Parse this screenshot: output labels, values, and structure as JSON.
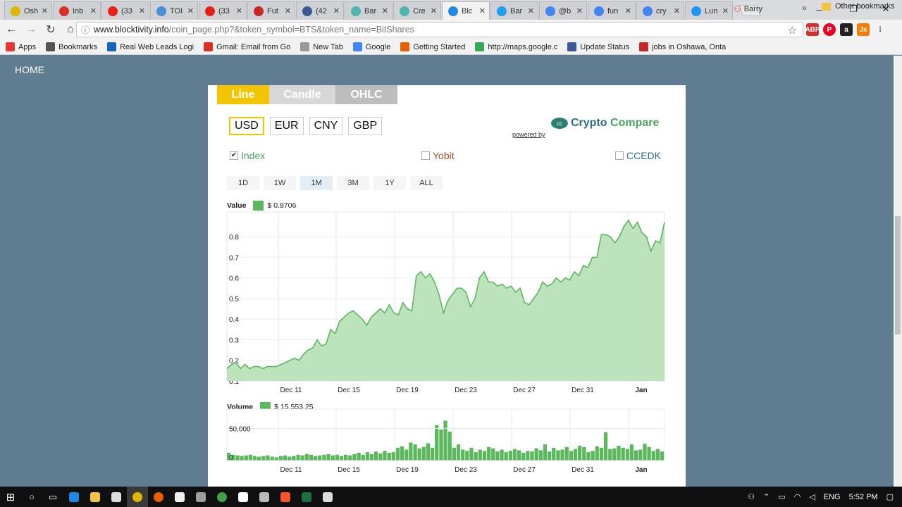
{
  "browser": {
    "tabs": [
      {
        "label": "Osh",
        "color": "#e0b500"
      },
      {
        "label": "Inb",
        "color": "#d93025"
      },
      {
        "label": "(33",
        "color": "#e62117"
      },
      {
        "label": "TOI",
        "color": "#4a90d9"
      },
      {
        "label": "(33",
        "color": "#e62117"
      },
      {
        "label": "Fut",
        "color": "#c62828"
      },
      {
        "label": "(42",
        "color": "#3b5998"
      },
      {
        "label": "Bar",
        "color": "#4db6ac"
      },
      {
        "label": "Cre",
        "color": "#4db6ac"
      },
      {
        "label": "Blc",
        "color": "#1e88e5"
      },
      {
        "label": "Bar",
        "color": "#1da1f2"
      },
      {
        "label": "@b",
        "color": "#4285f4"
      },
      {
        "label": "fun",
        "color": "#4285f4"
      },
      {
        "label": "cry",
        "color": "#4285f4"
      },
      {
        "label": "Lun",
        "color": "#2196f3"
      }
    ],
    "active_tab": 9,
    "profile": "Barry",
    "url_host": "www.blocktivity.info",
    "url_path": "/coin_page.php?&token_symbol=BTS&token_name=BitShares",
    "bookmarks": [
      {
        "label": "Apps",
        "color": "#e53935"
      },
      {
        "label": "Bookmarks",
        "color": "#555"
      },
      {
        "label": "Real Web Leads Logi",
        "color": "#1565c0"
      },
      {
        "label": "Gmail: Email from Go",
        "color": "#d93025"
      },
      {
        "label": "New Tab",
        "color": "#999"
      },
      {
        "label": "Google",
        "color": "#4285f4"
      },
      {
        "label": "Getting Started",
        "color": "#e66000"
      },
      {
        "label": "http://maps.google.c",
        "color": "#34a853"
      },
      {
        "label": "Update Status",
        "color": "#3b5998"
      },
      {
        "label": "jobs in Oshawa, Onta",
        "color": "#c62828"
      }
    ],
    "bookmarks_more": "»",
    "other_bookmarks": "Other bookmarks"
  },
  "page": {
    "home": "HOME",
    "chart_tabs": [
      {
        "label": "Line",
        "color": "#f2c500"
      },
      {
        "label": "Candle",
        "color": "#d7d7d7"
      },
      {
        "label": "OHLC",
        "color": "#bdbdbd"
      }
    ],
    "currencies": [
      "USD",
      "EUR",
      "CNY",
      "GBP"
    ],
    "selected_currency": "USD",
    "powered_by": "powered by",
    "cc_name_a": "Crypto",
    "cc_name_b": "Compare",
    "exchanges": [
      {
        "label": "Index",
        "checked": "✔",
        "color": "#4aa35d"
      },
      {
        "label": "Yobit",
        "checked": "",
        "color": "#a0522d"
      },
      {
        "label": "CCEDK",
        "checked": "",
        "color": "#2d6c8a"
      }
    ],
    "ranges": [
      "1D",
      "1W",
      "1M",
      "3M",
      "1Y",
      "ALL"
    ],
    "selected_range": "1M",
    "value_label": "Value",
    "value_readout": "$ 0.8706",
    "volume_label": "Volume",
    "volume_readout": "$ 15,553.25"
  },
  "chart_data": [
    {
      "type": "area",
      "title": "",
      "y_ticks": [
        "0.1",
        "0.2",
        "0.3",
        "0.4",
        "0.5",
        "0.6",
        "0.7",
        "0.8"
      ],
      "ylim": [
        0.1,
        0.92
      ],
      "x_ticks": [
        "Dec 11",
        "Dec 15",
        "Dec 19",
        "Dec 23",
        "Dec 27",
        "Dec 31",
        "Jan"
      ],
      "grid": true,
      "color": "#5cb85c",
      "values": [
        0.16,
        0.18,
        0.19,
        0.16,
        0.18,
        0.16,
        0.17,
        0.17,
        0.16,
        0.17,
        0.17,
        0.17,
        0.18,
        0.19,
        0.2,
        0.21,
        0.2,
        0.23,
        0.25,
        0.26,
        0.3,
        0.27,
        0.28,
        0.35,
        0.33,
        0.39,
        0.41,
        0.43,
        0.44,
        0.42,
        0.4,
        0.37,
        0.41,
        0.43,
        0.45,
        0.43,
        0.47,
        0.43,
        0.42,
        0.48,
        0.45,
        0.44,
        0.61,
        0.63,
        0.6,
        0.62,
        0.58,
        0.52,
        0.43,
        0.49,
        0.52,
        0.55,
        0.55,
        0.53,
        0.46,
        0.5,
        0.6,
        0.63,
        0.58,
        0.58,
        0.56,
        0.57,
        0.55,
        0.56,
        0.53,
        0.55,
        0.48,
        0.47,
        0.5,
        0.53,
        0.58,
        0.56,
        0.57,
        0.6,
        0.58,
        0.6,
        0.59,
        0.63,
        0.61,
        0.66,
        0.65,
        0.7,
        0.7,
        0.81,
        0.81,
        0.8,
        0.77,
        0.8,
        0.85,
        0.88,
        0.84,
        0.87,
        0.82,
        0.8,
        0.73,
        0.78,
        0.77,
        0.87
      ]
    },
    {
      "type": "bar",
      "title": "",
      "y_ticks": [
        "0",
        "50,000"
      ],
      "ylim": [
        0,
        80000
      ],
      "x_ticks": [
        "Dec 11",
        "Dec 15",
        "Dec 19",
        "Dec 23",
        "Dec 27",
        "Dec 31",
        "Jan"
      ],
      "color": "#5cb85c",
      "values": [
        12000,
        9000,
        8000,
        7000,
        8000,
        9000,
        7000,
        6000,
        7000,
        8000,
        6000,
        5000,
        7000,
        8000,
        6000,
        7000,
        9000,
        8000,
        10000,
        9000,
        7000,
        8000,
        9000,
        10000,
        8000,
        9000,
        7000,
        9000,
        8000,
        10000,
        12000,
        9000,
        13000,
        10000,
        14000,
        11000,
        15000,
        12000,
        13000,
        20000,
        22000,
        17000,
        28000,
        25000,
        19000,
        21000,
        27000,
        20000,
        55000,
        48000,
        62000,
        45000,
        20000,
        25000,
        17000,
        15000,
        20000,
        13000,
        17000,
        15000,
        21000,
        19000,
        14000,
        17000,
        13000,
        15000,
        18000,
        16000,
        12000,
        15000,
        14000,
        19000,
        16000,
        25000,
        14000,
        20000,
        16000,
        17000,
        21000,
        15000,
        18000,
        23000,
        21000,
        13000,
        15000,
        22000,
        20000,
        44000,
        18000,
        19000,
        23000,
        20000,
        18000,
        25000,
        16000,
        17000,
        26000,
        21000,
        15000,
        18000,
        14000
      ]
    }
  ]
}
